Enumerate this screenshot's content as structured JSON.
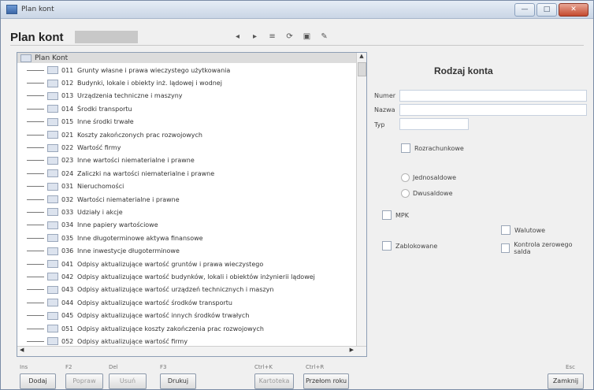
{
  "window": {
    "title": "Plan kont",
    "buttons": [
      "—",
      "□",
      "✕"
    ]
  },
  "header": {
    "title": "Plan kont"
  },
  "tree": {
    "root": "Plan Kont",
    "items": [
      {
        "code": "011",
        "name": "Grunty własne i prawa wieczystego użytkowania"
      },
      {
        "code": "012",
        "name": "Budynki, lokale i obiekty inż. lądowej i wodnej"
      },
      {
        "code": "013",
        "name": "Urządzenia techniczne i maszyny"
      },
      {
        "code": "014",
        "name": "Środki transportu"
      },
      {
        "code": "015",
        "name": "Inne środki trwałe"
      },
      {
        "code": "021",
        "name": "Koszty zakończonych prac rozwojowych"
      },
      {
        "code": "022",
        "name": "Wartość firmy"
      },
      {
        "code": "023",
        "name": "Inne wartości niematerialne i prawne"
      },
      {
        "code": "024",
        "name": "Zaliczki na wartości niematerialne i prawne"
      },
      {
        "code": "031",
        "name": "Nieruchomości"
      },
      {
        "code": "032",
        "name": "Wartości niematerialne i prawne"
      },
      {
        "code": "033",
        "name": "Udziały i akcje"
      },
      {
        "code": "034",
        "name": "Inne papiery wartościowe"
      },
      {
        "code": "035",
        "name": "Inne długoterminowe aktywa finansowe"
      },
      {
        "code": "036",
        "name": "Inne inwestycje długoterminowe"
      },
      {
        "code": "041",
        "name": "Odpisy aktualizujące wartość gruntów i prawa wieczystego"
      },
      {
        "code": "042",
        "name": "Odpisy aktualizujące wartość budynków, lokali i obiektów inżynierii lądowej"
      },
      {
        "code": "043",
        "name": "Odpisy aktualizujące wartość urządzeń technicznych i maszyn"
      },
      {
        "code": "044",
        "name": "Odpisy aktualizujące wartość środków transportu"
      },
      {
        "code": "045",
        "name": "Odpisy aktualizujące wartość innych środków trwałych"
      },
      {
        "code": "051",
        "name": "Odpisy aktualizujące koszty zakończenia prac rozwojowych"
      },
      {
        "code": "052",
        "name": "Odpisy aktualizujące wartość firmy"
      }
    ]
  },
  "form": {
    "title": "Rodzaj konta",
    "labels": {
      "numer": "Numer",
      "nazwa": "Nazwa",
      "typ": "Typ"
    },
    "checkboxes": {
      "rozrachunkowe": "Rozrachunkowe",
      "mpk": "MPK",
      "walutowe": "Walutowe",
      "zablokowane": "Zablokowane",
      "kontrola": "Kontrola zerowego salda"
    },
    "radios": {
      "jednosaldowe": "Jednosaldowe",
      "dwusaldowe": "Dwusaldowe"
    }
  },
  "footer": {
    "hints": {
      "ins": "Ins",
      "f2": "F2",
      "del": "Del",
      "f3": "F3",
      "ctrlk": "Ctrl+K",
      "ctrlr": "Ctrl+R",
      "esc": "Esc"
    },
    "buttons": {
      "dodaj": "Dodaj",
      "popraw": "Popraw",
      "usun": "Usuń",
      "drukuj": "Drukuj",
      "kartoteka": "Kartoteka",
      "przelom": "Przełom roku",
      "zamknij": "Zamknij"
    }
  }
}
